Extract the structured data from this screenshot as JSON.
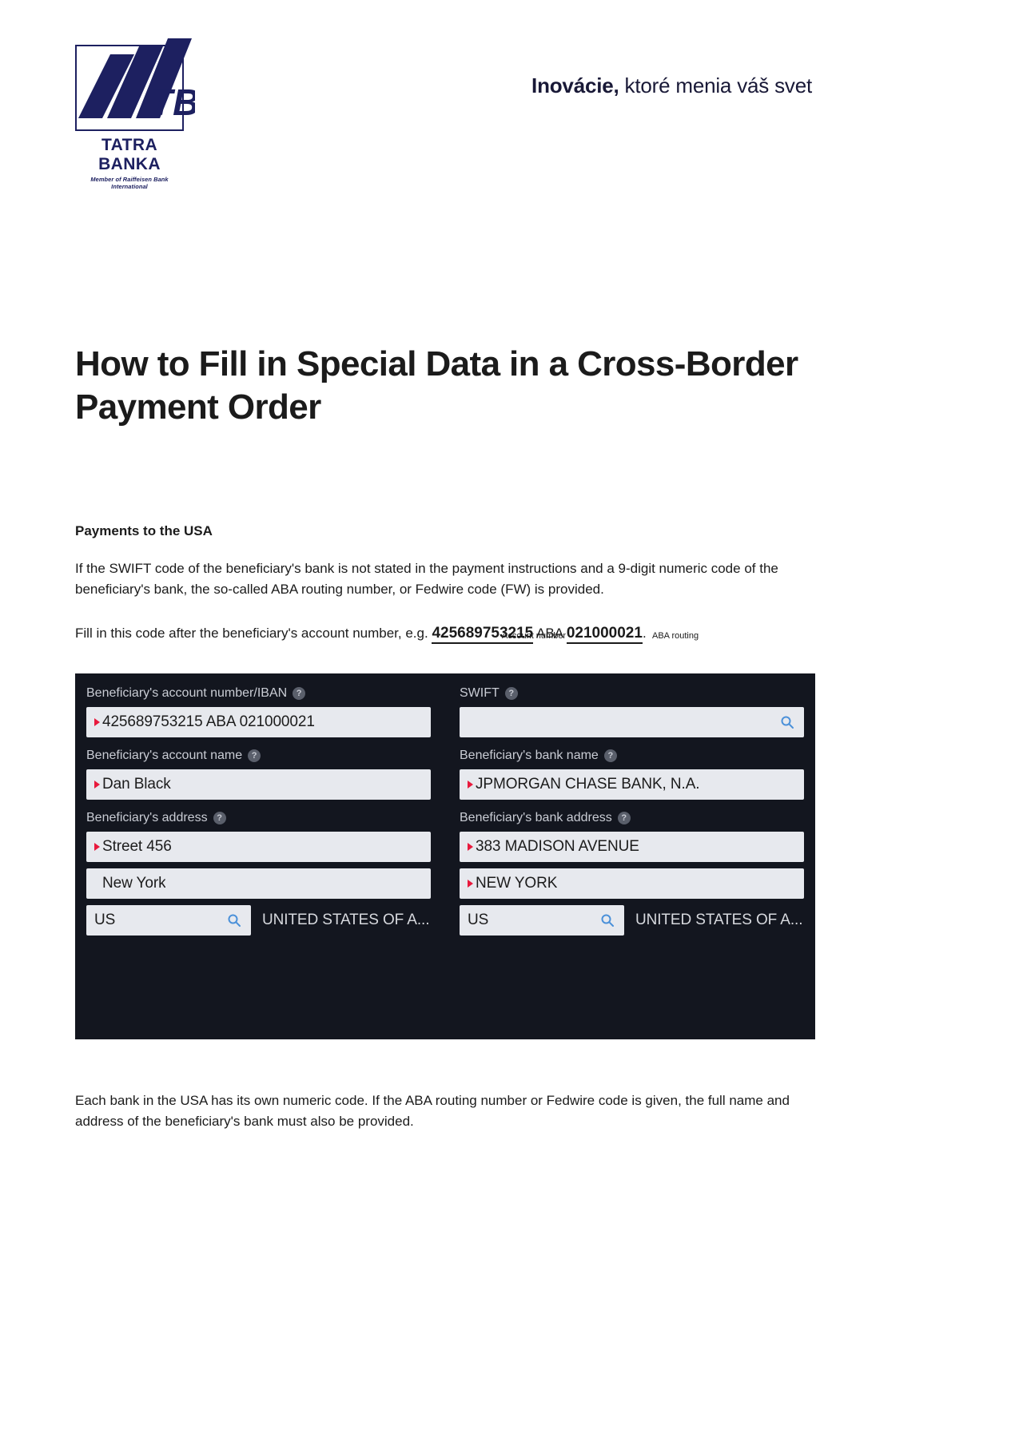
{
  "header": {
    "logo": {
      "mark_text": "TB",
      "name": "TATRA BANKA",
      "subtitle": "Member of Raiffeisen Bank International",
      "brand_color": "#1d2060"
    },
    "tagline_bold": "Inovácie,",
    "tagline_rest": " ktoré menia váš svet"
  },
  "document": {
    "title": "How to Fill in Special Data in a Cross-Border Payment Order",
    "section_heading": "Payments to the USA",
    "paragraph_1": "If the SWIFT code of the beneficiary's bank is not stated in the payment instructions and a 9-digit numeric code of the beneficiary's bank, the so-called ABA routing number, or Fedwire code (FW) is provided.",
    "example_lead": "Fill in this code after the beneficiary's account number, e.g. ",
    "example_account": "425689753215",
    "example_mid": " ABA ",
    "example_aba": "021000021",
    "example_end": ".",
    "caption_account": "Account number",
    "caption_aba": "ABA routing",
    "paragraph_2": "Each bank in the USA has its own numeric code. If the ABA routing number or Fedwire code is given, the full name and address of the beneficiary's bank must also be provided."
  },
  "form": {
    "background_color": "#13161f",
    "field_background": "#e7e9ee",
    "marker_color": "#e8193c",
    "help_glyph": "?",
    "left": {
      "account_number_label": "Beneficiary's account number/IBAN",
      "account_number_value": "425689753215 ABA 021000021",
      "account_name_label": "Beneficiary's account name",
      "account_name_value": "Dan Black",
      "address_label": "Beneficiary's address",
      "address_street_value": "Street 456",
      "address_city_value": "New York",
      "country_code_value": "US",
      "country_name_value": "UNITED STATES OF A..."
    },
    "right": {
      "swift_label": "SWIFT",
      "swift_value": "",
      "bank_name_label": "Beneficiary's bank name",
      "bank_name_value": "JPMORGAN CHASE BANK, N.A.",
      "bank_address_label": "Beneficiary's bank address",
      "bank_address_street_value": "383 MADISON AVENUE",
      "bank_address_city_value": "NEW YORK",
      "country_code_value": "US",
      "country_name_value": "UNITED STATES OF A..."
    }
  }
}
